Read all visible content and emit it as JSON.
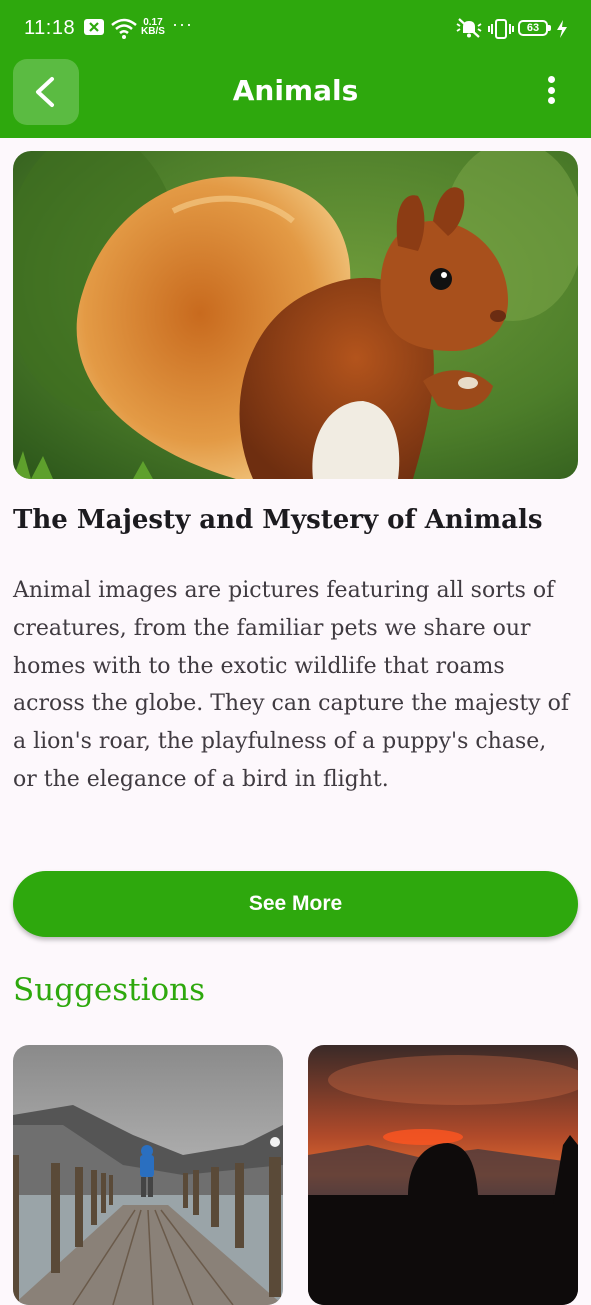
{
  "status_bar": {
    "time": "11:18",
    "net_speed_value": "0.17",
    "net_speed_unit": "KB/S",
    "battery": "63",
    "overflow_dots": "···"
  },
  "app_bar": {
    "title": "Animals",
    "back_icon": "chevron-left-icon",
    "menu_icon": "more-vertical-icon"
  },
  "article": {
    "title": "The Majesty and Mystery of Animals",
    "body": "Animal images are pictures featuring all sorts of creatures, from the familiar pets we share our homes with to the exotic wildlife that roams across the globe. They can capture the majesty of a lion's roar, the playfulness of a puppy's chase, or the elegance of a bird in flight.",
    "button_label": "See More"
  },
  "suggestions": {
    "heading": "Suggestions"
  },
  "colors": {
    "primary": "#2ea80d",
    "background": "#fdf8fc",
    "text": "#1c1b1f"
  }
}
